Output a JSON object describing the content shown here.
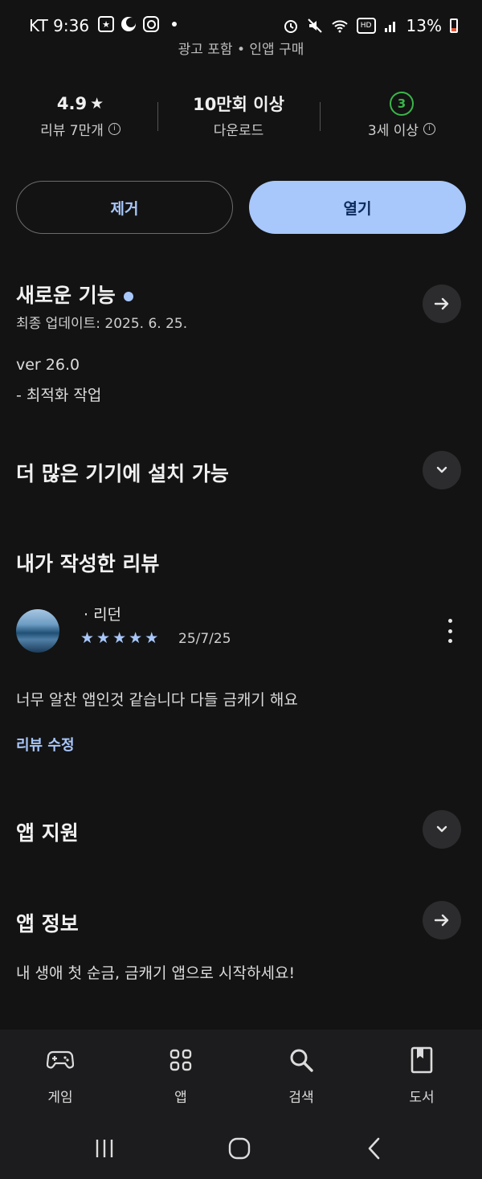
{
  "status_bar": {
    "time": "KT 9:36",
    "battery": "13%",
    "hd_badge": "HD",
    "icons": [
      "star-badge-icon",
      "moon-icon",
      "instagram-icon",
      "dot-icon",
      "alarm-icon",
      "mute-icon",
      "wifi-icon",
      "hd-icon",
      "signal-icon",
      "battery-icon"
    ]
  },
  "header": {
    "subtitle": "광고 포함 • 인앱 구매"
  },
  "stats": {
    "rating_value": "4.9",
    "rating_star": "★",
    "rating_label": "리뷰 7만개",
    "downloads_value": "10만회 이상",
    "downloads_label": "다운로드",
    "age_badge": "3",
    "age_label": "3세 이상"
  },
  "buttons": {
    "remove": "제거",
    "open": "열기"
  },
  "whats_new": {
    "title": "새로운 기능",
    "updated": "최종 업데이트: 2025. 6. 25.",
    "version": "ver 26.0",
    "note": "- 최적화 작업"
  },
  "more_devices": {
    "title": "더 많은 기기에 설치 가능"
  },
  "my_review": {
    "title": "내가 작성한 리뷰",
    "author": "· 리던",
    "rating": 5,
    "date": "25/7/25",
    "text": "너무 알찬 앱인것 같습니다 다들 금캐기 해요",
    "edit_label": "리뷰 수정"
  },
  "app_support": {
    "title": "앱 지원"
  },
  "app_info": {
    "title": "앱 정보",
    "description": "내 생애 첫 순금, 금캐기 앱으로 시작하세요!"
  },
  "bottom_nav": {
    "items": [
      {
        "label": "게임",
        "icon": "gamepad-icon"
      },
      {
        "label": "앱",
        "icon": "apps-grid-icon"
      },
      {
        "label": "검색",
        "icon": "search-icon"
      },
      {
        "label": "도서",
        "icon": "book-icon"
      }
    ]
  },
  "system_nav": {
    "icons": [
      "recent-apps-icon",
      "home-icon",
      "back-icon"
    ]
  },
  "colors": {
    "background": "#131313",
    "accent": "#a8c7fa",
    "age_green": "#3bb54a"
  }
}
